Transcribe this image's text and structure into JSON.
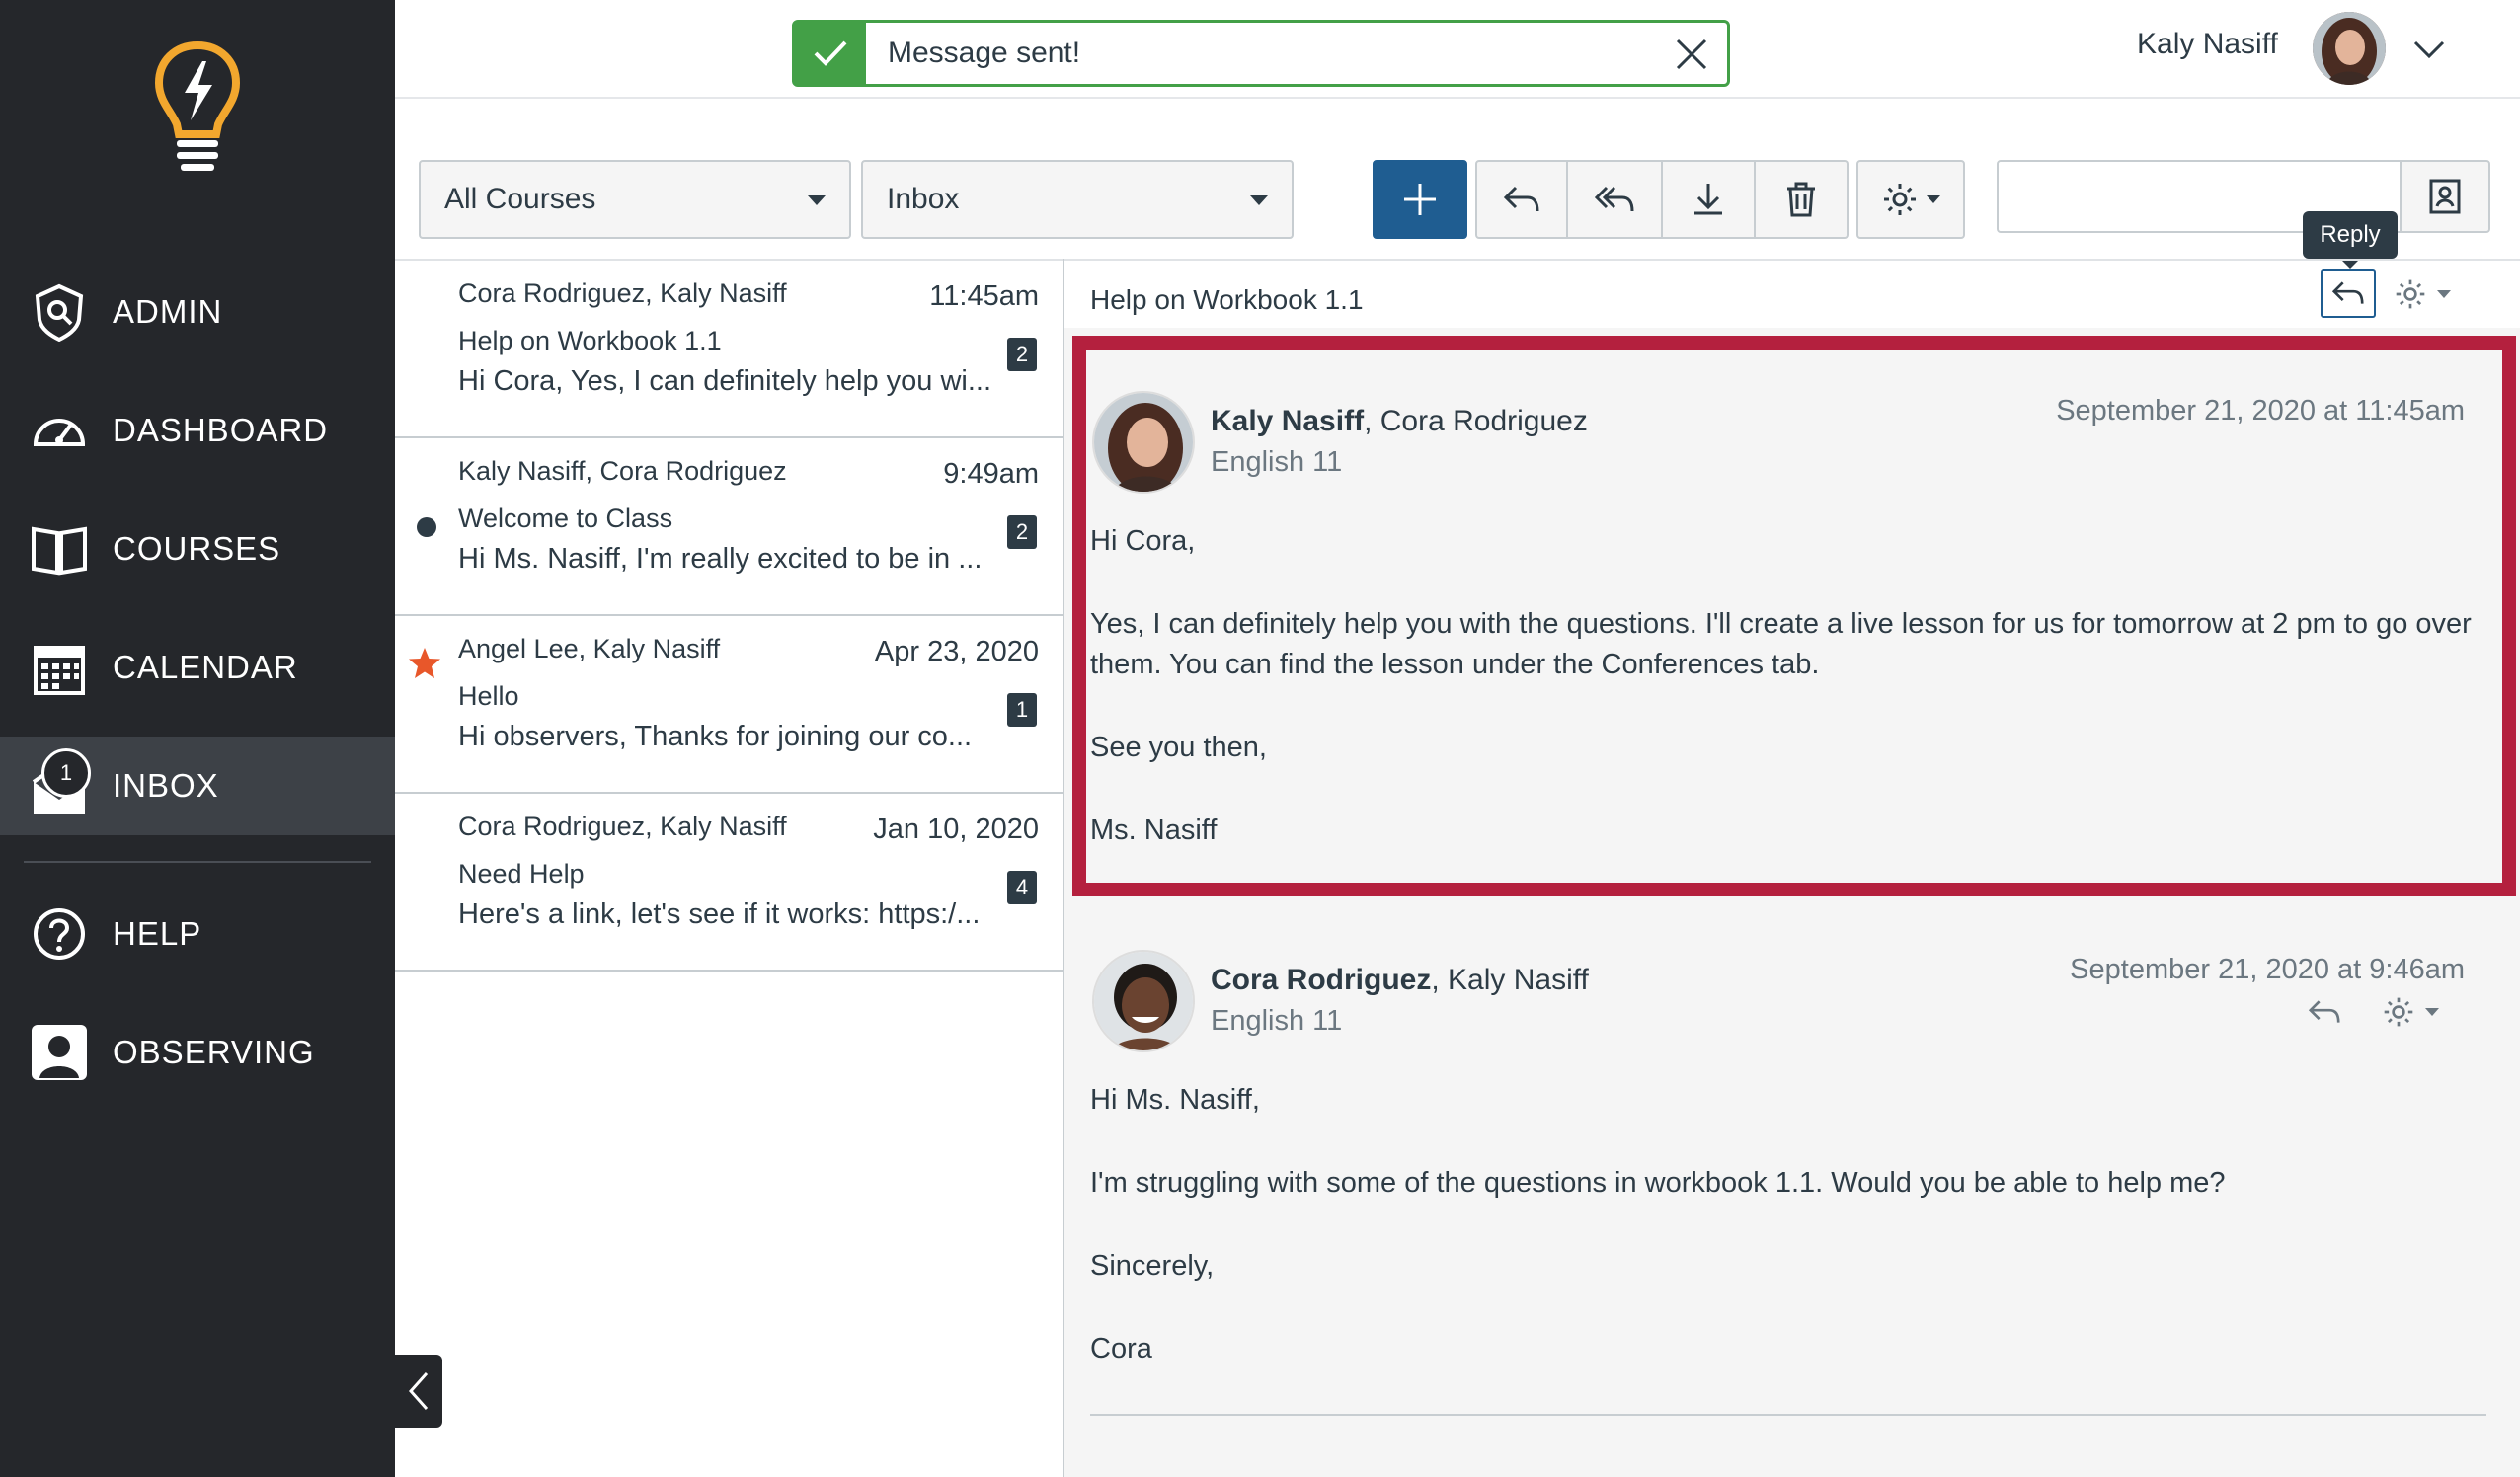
{
  "sidebar": {
    "items": [
      {
        "label": "ADMIN",
        "icon": "admin-shield-icon"
      },
      {
        "label": "DASHBOARD",
        "icon": "speedometer-icon"
      },
      {
        "label": "COURSES",
        "icon": "book-icon"
      },
      {
        "label": "CALENDAR",
        "icon": "calendar-icon"
      },
      {
        "label": "INBOX",
        "icon": "envelope-icon",
        "badge": "1"
      },
      {
        "label": "HELP",
        "icon": "help-circle-icon"
      },
      {
        "label": "OBSERVING",
        "icon": "person-icon"
      }
    ]
  },
  "header": {
    "toast": "Message sent!",
    "user_name": "Kaly Nasiff"
  },
  "toolbar": {
    "course_filter": "All Courses",
    "folder_filter": "Inbox",
    "tooltip": "Reply"
  },
  "messages": [
    {
      "people": "Cora Rodriguez, Kaly Nasiff",
      "date": "11:45am",
      "subject": "Help on Workbook 1.1",
      "preview": "Hi Cora, Yes, I can definitely help you wi...",
      "count": "2"
    },
    {
      "people": "Kaly Nasiff, Cora Rodriguez",
      "date": "9:49am",
      "subject": "Welcome to Class",
      "preview": "Hi Ms. Nasiff, I'm really excited to be in ...",
      "count": "2"
    },
    {
      "people": "Angel Lee, Kaly Nasiff",
      "date": "Apr 23, 2020",
      "subject": "Hello",
      "preview": "Hi observers, Thanks for joining our co...",
      "count": "1"
    },
    {
      "people": "Cora Rodriguez, Kaly Nasiff",
      "date": "Jan 10, 2020",
      "subject": "Need Help",
      "preview": "Here's a link, let's see if it works: https:/...",
      "count": "4"
    }
  ],
  "conversation": {
    "subject": "Help on Workbook 1.1",
    "messages": [
      {
        "author": "Kaly Nasiff",
        "others": ", Cora Rodriguez",
        "course": "English 11",
        "date": "September 21, 2020 at 11:45am",
        "body": [
          "Hi Cora,",
          "Yes, I can definitely help you with the questions. I'll create a live lesson for us for tomorrow at 2 pm to go over them. You can find the lesson under the Conferences tab.",
          "See you then,",
          "Ms. Nasiff"
        ]
      },
      {
        "author": "Cora Rodriguez",
        "others": ", Kaly Nasiff",
        "course": "English 11",
        "date": "September 21, 2020 at 9:46am",
        "body": [
          "Hi Ms. Nasiff,",
          "I'm struggling with some of the questions in workbook 1.1. Would you be able to help me?",
          "Sincerely,",
          "Cora"
        ]
      }
    ]
  },
  "colors": {
    "sidebar_bg": "#25272b",
    "primary": "#1f5d91",
    "success": "#43a047",
    "highlight": "#b4203e",
    "star": "#e8572a",
    "logo": "#f2a72e"
  }
}
